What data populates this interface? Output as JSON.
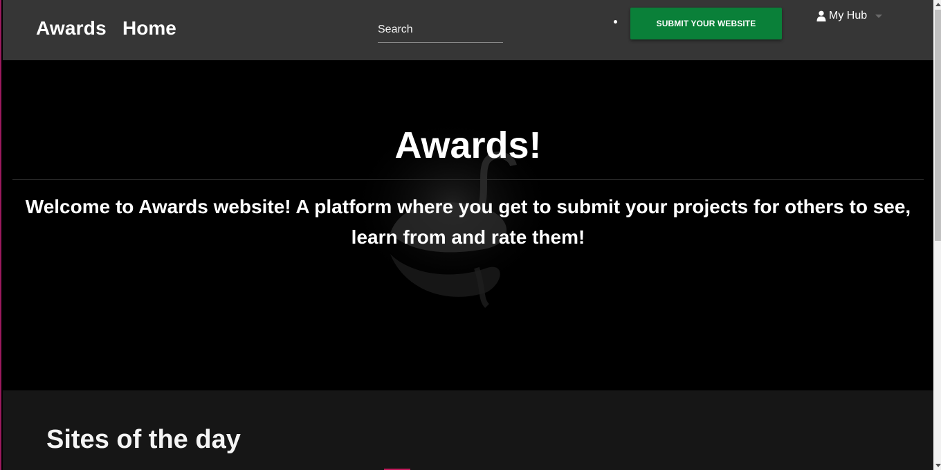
{
  "navbar": {
    "brand": "Awards",
    "home_link": "Home",
    "search": {
      "placeholder": "Search",
      "value": ""
    },
    "submit_button": "SUBMIT YOUR WEBSITE",
    "submit_color": "#0a8039",
    "user_menu": {
      "label": "My Hub",
      "icon": "user-icon"
    }
  },
  "hero": {
    "title": "Awards!",
    "description": "Welcome to Awards website! A platform where you get to submit your projects for others to see, learn from and rate them!"
  },
  "sites_section": {
    "title": "Sites of the day"
  }
}
